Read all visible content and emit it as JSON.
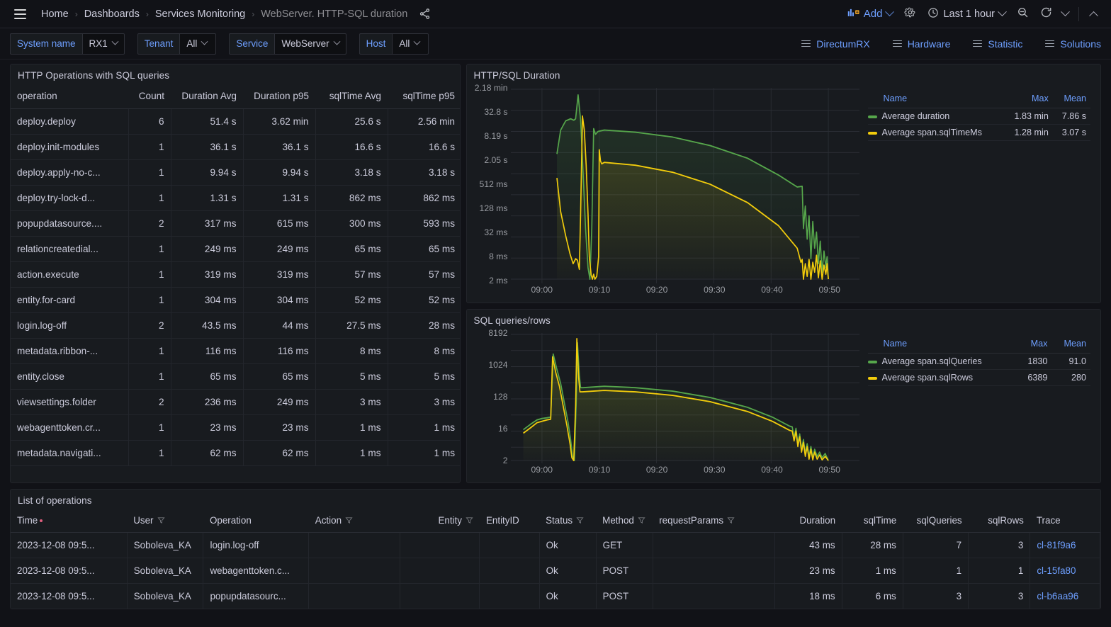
{
  "topnav": {
    "menu_icon": "hamburger-icon",
    "breadcrumbs": [
      {
        "label": "Home",
        "current": false
      },
      {
        "label": "Dashboards",
        "current": false
      },
      {
        "label": "Services Monitoring",
        "current": false
      },
      {
        "label": "WebServer. HTTP-SQL duration",
        "current": true
      }
    ],
    "separator": "›",
    "share_icon": "share-icon",
    "add_label": "Add",
    "settings_icon": "gear-icon",
    "time_range": "Last 1 hour",
    "clock_icon": "clock-icon",
    "zoom_out_icon": "zoom-out-icon",
    "refresh_icon": "refresh-icon",
    "collapse_icon": "chevron-up-icon"
  },
  "varbar": {
    "variables": [
      {
        "label": "System name",
        "value": "RX1"
      },
      {
        "label": "Tenant",
        "value": "All"
      },
      {
        "label": "Service",
        "value": "WebServer"
      },
      {
        "label": "Host",
        "value": "All"
      }
    ],
    "links": [
      "DirectumRX",
      "Hardware",
      "Statistic",
      "Solutions"
    ]
  },
  "ops_panel": {
    "title": "HTTP Operations with SQL queries",
    "columns": [
      "operation",
      "Count",
      "Duration Avg",
      "Duration p95",
      "sqlTime Avg",
      "sqlTime p95"
    ],
    "rows": [
      [
        "deploy.deploy",
        "6",
        "51.4 s",
        "3.62 min",
        "25.6 s",
        "2.56 min"
      ],
      [
        "deploy.init-modules",
        "1",
        "36.1 s",
        "36.1 s",
        "16.6 s",
        "16.6 s"
      ],
      [
        "deploy.apply-no-c...",
        "1",
        "9.94 s",
        "9.94 s",
        "3.18 s",
        "3.18 s"
      ],
      [
        "deploy.try-lock-d...",
        "1",
        "1.31 s",
        "1.31 s",
        "862 ms",
        "862 ms"
      ],
      [
        "popupdatasource....",
        "2",
        "317 ms",
        "615 ms",
        "300 ms",
        "593 ms"
      ],
      [
        "relationcreatedial...",
        "1",
        "249 ms",
        "249 ms",
        "65 ms",
        "65 ms"
      ],
      [
        "action.execute",
        "1",
        "319 ms",
        "319 ms",
        "57 ms",
        "57 ms"
      ],
      [
        "entity.for-card",
        "1",
        "304 ms",
        "304 ms",
        "52 ms",
        "52 ms"
      ],
      [
        "login.log-off",
        "2",
        "43.5 ms",
        "44 ms",
        "27.5 ms",
        "28 ms"
      ],
      [
        "metadata.ribbon-...",
        "1",
        "116 ms",
        "116 ms",
        "8 ms",
        "8 ms"
      ],
      [
        "entity.close",
        "1",
        "65 ms",
        "65 ms",
        "5 ms",
        "5 ms"
      ],
      [
        "viewsettings.folder",
        "2",
        "236 ms",
        "249 ms",
        "3 ms",
        "3 ms"
      ],
      [
        "webagenttoken.cr...",
        "1",
        "23 ms",
        "23 ms",
        "1 ms",
        "1 ms"
      ],
      [
        "metadata.navigati...",
        "1",
        "62 ms",
        "62 ms",
        "1 ms",
        "1 ms"
      ]
    ]
  },
  "chart_data": [
    {
      "type": "line",
      "title": "HTTP/SQL Duration",
      "xlabel": "",
      "ylabel": "",
      "yscale": "log",
      "yticks": [
        "2 ms",
        "8 ms",
        "32 ms",
        "128 ms",
        "512 ms",
        "2.05 s",
        "8.19 s",
        "32.8 s",
        "2.18 min"
      ],
      "xticks": [
        "09:00",
        "09:10",
        "09:20",
        "09:30",
        "09:40",
        "09:50"
      ],
      "legend_position": "right",
      "legend_columns": [
        "Name",
        "Max",
        "Mean"
      ],
      "grid": true,
      "series": [
        {
          "name": "Average duration",
          "color": "#56A64B",
          "max": "1.83 min",
          "mean": "7.86 s"
        },
        {
          "name": "Average span.sqlTimeMs",
          "color": "#F2CC0C",
          "max": "1.28 min",
          "mean": "3.07 s"
        }
      ]
    },
    {
      "type": "line",
      "title": "SQL queries/rows",
      "xlabel": "",
      "ylabel": "",
      "yscale": "log",
      "yticks": [
        "2",
        "16",
        "128",
        "1024",
        "8192"
      ],
      "xticks": [
        "09:00",
        "09:10",
        "09:20",
        "09:30",
        "09:40",
        "09:50"
      ],
      "legend_position": "right",
      "legend_columns": [
        "Name",
        "Max",
        "Mean"
      ],
      "grid": true,
      "series": [
        {
          "name": "Average span.sqlQueries",
          "color": "#56A64B",
          "max": "1830",
          "mean": "91.0"
        },
        {
          "name": "Average span.sqlRows",
          "color": "#F2CC0C",
          "max": "6389",
          "mean": "280"
        }
      ]
    }
  ],
  "list_panel": {
    "title": "List of operations",
    "columns": [
      {
        "label": "Time",
        "filter": false,
        "sorted": true,
        "align": "left"
      },
      {
        "label": "User",
        "filter": true,
        "align": "left"
      },
      {
        "label": "Operation",
        "filter": false,
        "align": "left"
      },
      {
        "label": "Action",
        "filter": true,
        "align": "left"
      },
      {
        "label": "Entity",
        "filter": true,
        "align": "right"
      },
      {
        "label": "EntityID",
        "filter": false,
        "align": "left"
      },
      {
        "label": "Status",
        "filter": true,
        "align": "left"
      },
      {
        "label": "Method",
        "filter": true,
        "align": "left"
      },
      {
        "label": "requestParams",
        "filter": true,
        "align": "left"
      },
      {
        "label": "Duration",
        "filter": false,
        "align": "right"
      },
      {
        "label": "sqlTime",
        "filter": false,
        "align": "right"
      },
      {
        "label": "sqlQueries",
        "filter": false,
        "align": "right"
      },
      {
        "label": "sqlRows",
        "filter": false,
        "align": "right"
      },
      {
        "label": "Trace",
        "filter": false,
        "align": "left"
      }
    ],
    "rows": [
      [
        "2023-12-08 09:5...",
        "Soboleva_KA",
        "login.log-off",
        "",
        "",
        "",
        "Ok",
        "GET",
        "",
        "43 ms",
        "28 ms",
        "7",
        "3",
        "cl-81f9a6"
      ],
      [
        "2023-12-08 09:5...",
        "Soboleva_KA",
        "webagenttoken.c...",
        "",
        "",
        "",
        "Ok",
        "POST",
        "",
        "23 ms",
        "1 ms",
        "1",
        "1",
        "cl-15fa80"
      ],
      [
        "2023-12-08 09:5...",
        "Soboleva_KA",
        "popupdatasourc...",
        "",
        "",
        "",
        "Ok",
        "POST",
        "",
        "18 ms",
        "6 ms",
        "3",
        "3",
        "cl-b6aa96"
      ]
    ]
  },
  "colors": {
    "green": "#56A64B",
    "yellow": "#F2CC0C",
    "accent_blue": "#6e9fff",
    "panel_bg": "#181b1f",
    "page_bg": "#111217"
  }
}
